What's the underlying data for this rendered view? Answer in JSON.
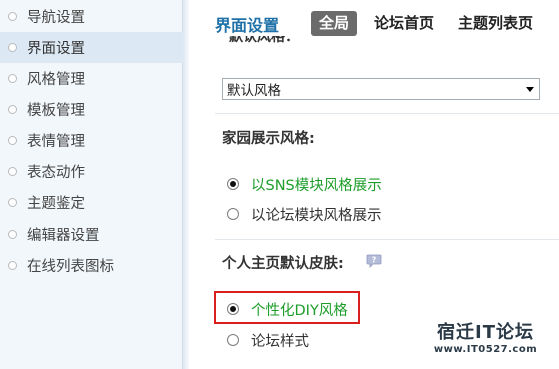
{
  "sidebar": {
    "items": [
      {
        "label": "导航设置",
        "active": false
      },
      {
        "label": "界面设置",
        "active": true
      },
      {
        "label": "风格管理",
        "active": false
      },
      {
        "label": "模板管理",
        "active": false
      },
      {
        "label": "表情管理",
        "active": false
      },
      {
        "label": "表态动作",
        "active": false
      },
      {
        "label": "主题鉴定",
        "active": false
      },
      {
        "label": "编辑器设置",
        "active": false
      },
      {
        "label": "在线列表图标",
        "active": false
      }
    ]
  },
  "header": {
    "title": "界面设置",
    "tabs": [
      {
        "label": "全局",
        "active": true
      },
      {
        "label": "论坛首页",
        "active": false
      },
      {
        "label": "主题列表页",
        "active": false
      }
    ]
  },
  "content": {
    "clipped_heading": "默认风格：",
    "style_select": {
      "value": "默认风格"
    },
    "home_display": {
      "title": "家园展示风格:",
      "options": [
        {
          "label": "以SNS模块风格展示",
          "checked": true
        },
        {
          "label": "以论坛模块风格展示",
          "checked": false
        }
      ]
    },
    "personal_skin": {
      "title": "个人主页默认皮肤:",
      "options": [
        {
          "label": "个性化DIY风格",
          "checked": true
        },
        {
          "label": "论坛样式",
          "checked": false
        }
      ]
    }
  },
  "watermark": {
    "name": "宿迁IT论坛",
    "url": "www.IT0527.com"
  },
  "colors": {
    "accent": "#1f71a8",
    "selected_option": "#1d9e2a",
    "highlight": "#d9201d",
    "active_tab": "#6b6b6b"
  }
}
